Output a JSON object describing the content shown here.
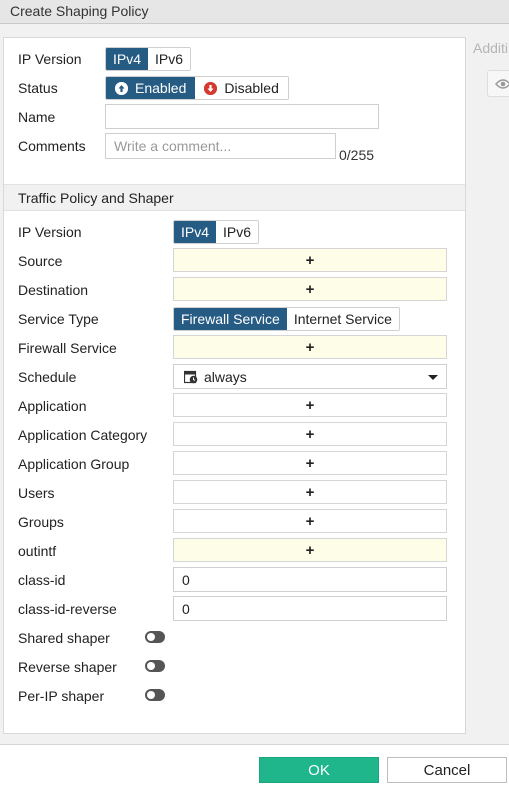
{
  "window": {
    "title": "Create Shaping Policy"
  },
  "side_panel": {
    "label": "Additi",
    "icon": "eye-icon"
  },
  "form": {
    "ip_version": {
      "label": "IP Version",
      "options": [
        "IPv4",
        "IPv6"
      ],
      "selected": "IPv4"
    },
    "status": {
      "label": "Status",
      "enabled_label": "Enabled",
      "disabled_label": "Disabled",
      "selected": "Enabled"
    },
    "name": {
      "label": "Name",
      "value": ""
    },
    "comments": {
      "label": "Comments",
      "placeholder": "Write a comment...",
      "counter": "0/255"
    }
  },
  "section": {
    "title": "Traffic Policy and Shaper",
    "ip_version": {
      "label": "IP Version",
      "options": [
        "IPv4",
        "IPv6"
      ],
      "selected": "IPv4"
    },
    "source": {
      "label": "Source",
      "plus": "+"
    },
    "destination": {
      "label": "Destination",
      "plus": "+"
    },
    "service_type": {
      "label": "Service Type",
      "options": [
        "Firewall Service",
        "Internet Service"
      ],
      "selected": "Firewall Service"
    },
    "firewall_service": {
      "label": "Firewall Service",
      "plus": "+"
    },
    "schedule": {
      "label": "Schedule",
      "value": "always"
    },
    "application": {
      "label": "Application",
      "plus": "+"
    },
    "application_category": {
      "label": "Application Category",
      "plus": "+"
    },
    "application_group": {
      "label": "Application Group",
      "plus": "+"
    },
    "users": {
      "label": "Users",
      "plus": "+"
    },
    "groups": {
      "label": "Groups",
      "plus": "+"
    },
    "outintf": {
      "label": "outintf",
      "plus": "+"
    },
    "class_id": {
      "label": "class-id",
      "value": "0"
    },
    "class_id_reverse": {
      "label": "class-id-reverse",
      "value": "0"
    },
    "shared_shaper": {
      "label": "Shared shaper",
      "on": false
    },
    "reverse_shaper": {
      "label": "Reverse shaper",
      "on": false
    },
    "per_ip_shaper": {
      "label": "Per-IP shaper",
      "on": false
    }
  },
  "footer": {
    "ok_label": "OK",
    "cancel_label": "Cancel"
  },
  "colors": {
    "accent": "#265b84",
    "ok": "#1fb68b",
    "required_bg": "#fdfde8",
    "disabled_icon": "#d43a2f"
  }
}
